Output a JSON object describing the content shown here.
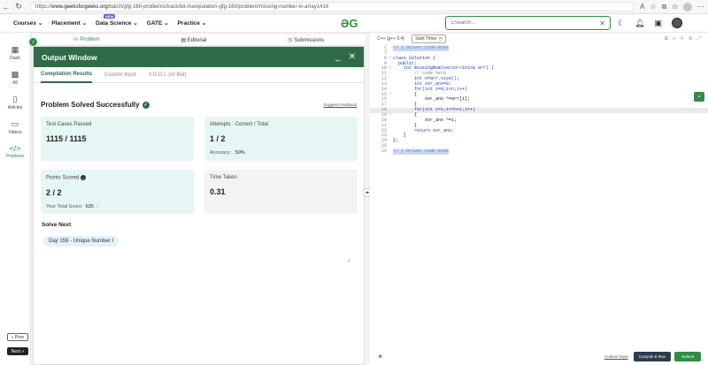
{
  "browser": {
    "url_prefix": "https://",
    "url_domain": "www.geeksforgeeks.org",
    "url_path": "/batch/gfg-160-problems/track/bit-manipulation-gfg-160/problem/missing-number-in-array1416"
  },
  "nav": {
    "items": [
      "Courses ⌄",
      "Placement ⌄",
      "Data Science ⌄",
      "GATE ⌄",
      "Practice ⌄"
    ],
    "new_badge": "NEW",
    "search_placeholder": "Search..."
  },
  "sidebar": {
    "items": [
      "Dash",
      "All",
      "Articles",
      "Videos",
      "Problems"
    ],
    "prev": "« Prev",
    "next": "Next »"
  },
  "problem_tabs": [
    "Problem",
    "Editorial",
    "Submissions"
  ],
  "output": {
    "title": "Output Window",
    "subtabs": [
      "Compilation Results",
      "Custom Input",
      "Y.O.G.I. (AI Bot)"
    ],
    "status": "Problem Solved Successfully",
    "feedback": "Suggest Feedback",
    "test_cases_label": "Test Cases Passed",
    "test_cases_value": "1115 / 1115",
    "attempts_label": "Attempts : Correct / Total",
    "attempts_value": "1 / 2",
    "accuracy_label": "Accuracy :",
    "accuracy_value": "50%",
    "points_label": "Points Scored",
    "points_value": "2 / 2",
    "total_score_label": "Your Total Score:",
    "total_score_value": "635",
    "time_label": "Time Taken",
    "time_value": "0.31",
    "solve_next_label": "Solve Next",
    "next_problem": "Day 159 - Unique Number I"
  },
  "editor": {
    "language": "C++ (g++ 5.4)",
    "timer_label": "Start Timer",
    "custom_input": "Custom Input",
    "compile_run": "Compile & Run",
    "submit": "Submit",
    "lines": [
      {
        "n": "1",
        "t": "// } Driver Code Ends"
      },
      {
        "n": "7",
        "t": ""
      },
      {
        "n": "8",
        "t": "class Solution {"
      },
      {
        "n": "9",
        "t": "  public:"
      },
      {
        "n": "10",
        "t": "    int missingNum(vector<int>& arr) {"
      },
      {
        "n": "11",
        "t": "        // code here"
      },
      {
        "n": "12",
        "t": "        int n=arr.size();"
      },
      {
        "n": "13",
        "t": "        int xor_ans=0;"
      },
      {
        "n": "14",
        "t": "        for(int i=0;i<n;i++)"
      },
      {
        "n": "15",
        "t": "        {"
      },
      {
        "n": "16",
        "t": "            xor_ans ^=arr[i];"
      },
      {
        "n": "17",
        "t": "        }"
      },
      {
        "n": "18",
        "t": "        for(int i=1;i<=n+1;i++)"
      },
      {
        "n": "19",
        "t": "        {"
      },
      {
        "n": "20",
        "t": "            xor_ans ^=i;"
      },
      {
        "n": "21",
        "t": "        }"
      },
      {
        "n": "22",
        "t": "        return xor_ans;"
      },
      {
        "n": "23",
        "t": "    }"
      },
      {
        "n": "24",
        "t": "};"
      },
      {
        "n": "25",
        "t": ""
      },
      {
        "n": "26",
        "t": "// } Driver Code Ends"
      }
    ]
  }
}
